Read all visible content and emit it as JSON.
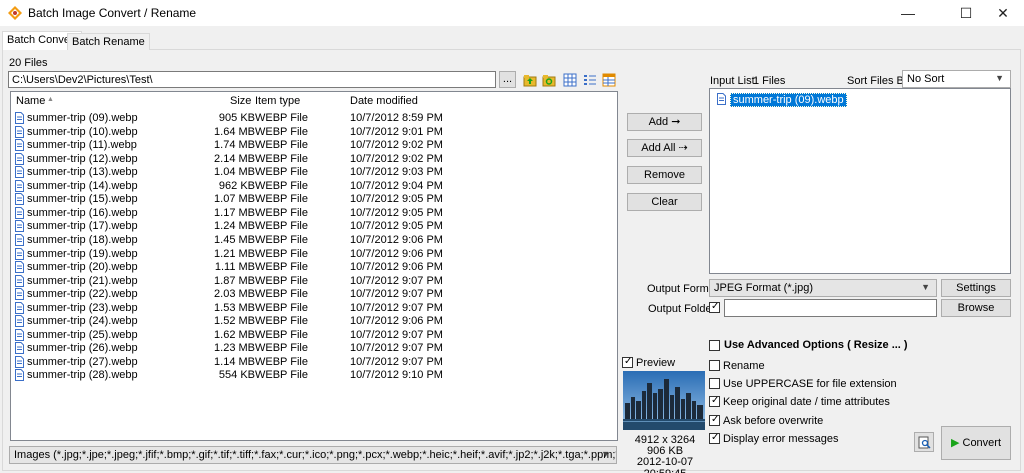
{
  "window": {
    "title": "Batch Image Convert / Rename",
    "minimize": "—",
    "maximize": "☐",
    "close": "✕"
  },
  "tabs": {
    "convert": "Batch Convert",
    "rename": "Batch Rename"
  },
  "file_count": "20 Files",
  "path": "C:\\Users\\Dev2\\Pictures\\Test\\",
  "browse_dots": "...",
  "columns": {
    "name": "Name",
    "size": "Size",
    "type": "Item type",
    "date": "Date modified"
  },
  "files": [
    {
      "name": "summer-trip (09).webp",
      "size": "905 KB",
      "type": "WEBP File",
      "date": "10/7/2012 8:59 PM"
    },
    {
      "name": "summer-trip (10).webp",
      "size": "1.64 MB",
      "type": "WEBP File",
      "date": "10/7/2012 9:01 PM"
    },
    {
      "name": "summer-trip (11).webp",
      "size": "1.74 MB",
      "type": "WEBP File",
      "date": "10/7/2012 9:02 PM"
    },
    {
      "name": "summer-trip (12).webp",
      "size": "2.14 MB",
      "type": "WEBP File",
      "date": "10/7/2012 9:02 PM"
    },
    {
      "name": "summer-trip (13).webp",
      "size": "1.04 MB",
      "type": "WEBP File",
      "date": "10/7/2012 9:03 PM"
    },
    {
      "name": "summer-trip (14).webp",
      "size": "962 KB",
      "type": "WEBP File",
      "date": "10/7/2012 9:04 PM"
    },
    {
      "name": "summer-trip (15).webp",
      "size": "1.07 MB",
      "type": "WEBP File",
      "date": "10/7/2012 9:05 PM"
    },
    {
      "name": "summer-trip (16).webp",
      "size": "1.17 MB",
      "type": "WEBP File",
      "date": "10/7/2012 9:05 PM"
    },
    {
      "name": "summer-trip (17).webp",
      "size": "1.24 MB",
      "type": "WEBP File",
      "date": "10/7/2012 9:05 PM"
    },
    {
      "name": "summer-trip (18).webp",
      "size": "1.45 MB",
      "type": "WEBP File",
      "date": "10/7/2012 9:06 PM"
    },
    {
      "name": "summer-trip (19).webp",
      "size": "1.21 MB",
      "type": "WEBP File",
      "date": "10/7/2012 9:06 PM"
    },
    {
      "name": "summer-trip (20).webp",
      "size": "1.11 MB",
      "type": "WEBP File",
      "date": "10/7/2012 9:06 PM"
    },
    {
      "name": "summer-trip (21).webp",
      "size": "1.87 MB",
      "type": "WEBP File",
      "date": "10/7/2012 9:07 PM"
    },
    {
      "name": "summer-trip (22).webp",
      "size": "2.03 MB",
      "type": "WEBP File",
      "date": "10/7/2012 9:07 PM"
    },
    {
      "name": "summer-trip (23).webp",
      "size": "1.53 MB",
      "type": "WEBP File",
      "date": "10/7/2012 9:07 PM"
    },
    {
      "name": "summer-trip (24).webp",
      "size": "1.52 MB",
      "type": "WEBP File",
      "date": "10/7/2012 9:06 PM"
    },
    {
      "name": "summer-trip (25).webp",
      "size": "1.62 MB",
      "type": "WEBP File",
      "date": "10/7/2012 9:07 PM"
    },
    {
      "name": "summer-trip (26).webp",
      "size": "1.23 MB",
      "type": "WEBP File",
      "date": "10/7/2012 9:07 PM"
    },
    {
      "name": "summer-trip (27).webp",
      "size": "1.14 MB",
      "type": "WEBP File",
      "date": "10/7/2012 9:07 PM"
    },
    {
      "name": "summer-trip (28).webp",
      "size": "554 KB",
      "type": "WEBP File",
      "date": "10/7/2012 9:10 PM"
    }
  ],
  "filter": "Images (*.jpg;*.jpe;*.jpeg;*.jfif;*.bmp;*.gif;*.tif;*.tiff;*.fax;*.cur;*.ico;*.png;*.pcx;*.webp;*.heic;*.heif;*.avif;*.jp2;*.j2k;*.tga;*.ppm;*.wmf;*.emf",
  "buttons": {
    "add": "Add",
    "add_all": "Add All",
    "remove": "Remove",
    "clear": "Clear",
    "settings": "Settings",
    "browse": "Browse",
    "convert": "Convert"
  },
  "input_list": {
    "label": "Input List:",
    "count": "1 Files",
    "items": [
      "summer-trip (09).webp"
    ]
  },
  "sort": {
    "label": "Sort Files By:",
    "value": "No Sort"
  },
  "output_format": {
    "label": "Output Format:",
    "value": "JPEG Format (*.jpg)"
  },
  "output_folder": {
    "label": "Output Folder:",
    "value": ""
  },
  "options": {
    "advanced": "Use Advanced Options ( Resize ... )",
    "rename": "Rename",
    "uppercase": "Use UPPERCASE for file extension",
    "keep_date": "Keep original date / time attributes",
    "ask_overwrite": "Ask before overwrite",
    "display_errors": "Display error messages"
  },
  "checks": {
    "preview": true,
    "output_folder": true,
    "advanced": false,
    "rename": false,
    "uppercase": false,
    "keep_date": true,
    "ask_overwrite": true,
    "display_errors": true
  },
  "preview": {
    "label": "Preview",
    "dimensions": "4912 x 3264",
    "size": "906 KB",
    "datetime": "2012-10-07 20:59:45"
  },
  "colors": {
    "selection": "#0078d7",
    "convert_icon": "#19a419",
    "folder_icon": "#e8b92c"
  }
}
